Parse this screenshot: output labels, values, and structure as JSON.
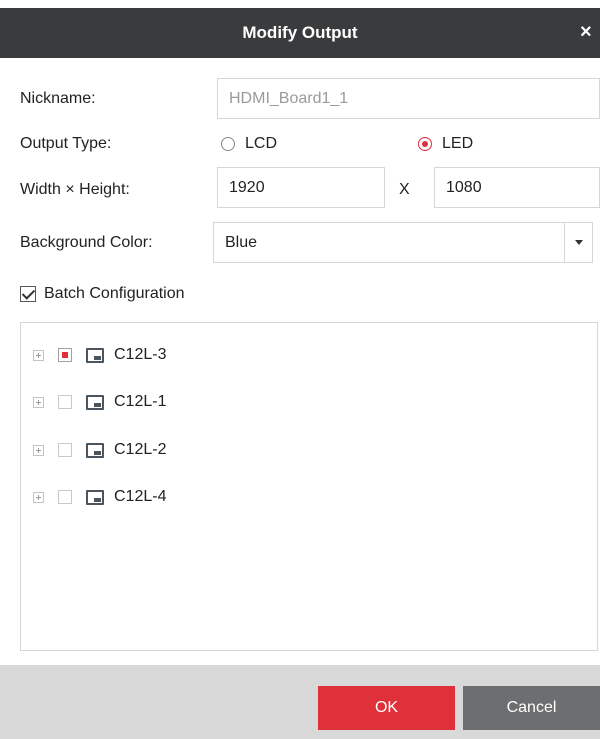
{
  "dialog": {
    "title": "Modify Output",
    "close_glyph": "×"
  },
  "form": {
    "nickname": {
      "label": "Nickname:",
      "value": "HDMI_Board1_1",
      "disabled": true
    },
    "output_type": {
      "label": "Output Type:",
      "options": [
        {
          "label": "LCD",
          "selected": false
        },
        {
          "label": "LED",
          "selected": true
        }
      ]
    },
    "size": {
      "label": "Width × Height:",
      "width": "1920",
      "separator": "X",
      "height": "1080"
    },
    "background_color": {
      "label": "Background Color:",
      "value": "Blue"
    },
    "batch_configuration": {
      "label": "Batch Configuration",
      "checked": true
    }
  },
  "tree": {
    "items": [
      {
        "label": "C12L-3",
        "check_state": "partial",
        "icon": "display-device-icon"
      },
      {
        "label": "C12L-1",
        "check_state": "unchecked",
        "icon": "display-device-icon"
      },
      {
        "label": "C12L-2",
        "check_state": "unchecked",
        "icon": "display-device-icon"
      },
      {
        "label": "C12L-4",
        "check_state": "unchecked",
        "icon": "display-device-icon"
      }
    ]
  },
  "footer": {
    "ok_label": "OK",
    "cancel_label": "Cancel"
  },
  "colors": {
    "title_bar": "#3a3b3d",
    "accent_red": "#e0303a",
    "cancel_gray": "#6d6e70",
    "footer_bg": "#d9d9d9"
  }
}
